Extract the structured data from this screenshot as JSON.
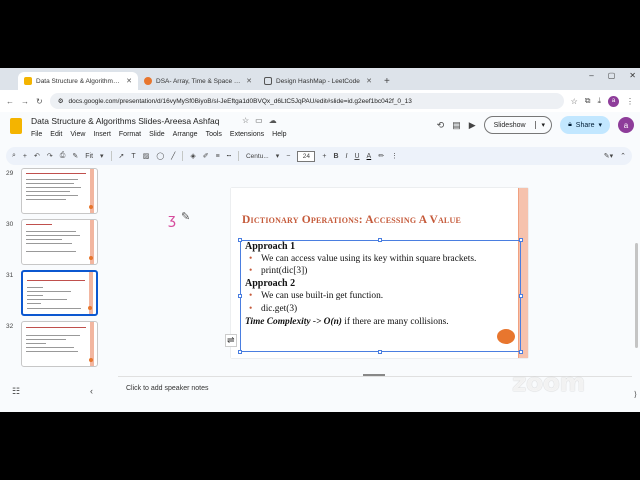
{
  "browser": {
    "tabs": [
      {
        "label": "Data Structure & Algorithms Sl",
        "active": true,
        "favicon_color": "#f4b400"
      },
      {
        "label": "DSA- Array, Time & Space Com",
        "active": false,
        "favicon_color": "#e8762e"
      },
      {
        "label": "Design HashMap - LeetCode",
        "active": false,
        "favicon_color": "#555555"
      }
    ],
    "new_tab": "+",
    "window_controls": [
      "–",
      "▢",
      "✕"
    ],
    "url": "docs.google.com/presentation/d/16vyMySf0BiyoB/sl-JeEftga1d0BVQx_d6LtC5JqPAU/edit#slide=id.g2eef1bc042f_0_13",
    "profile_initial": "a"
  },
  "doc": {
    "title": "Data Structure & Algorithms Slides-Areesa Ashfaq",
    "menu": [
      "File",
      "Edit",
      "View",
      "Insert",
      "Format",
      "Slide",
      "Arrange",
      "Tools",
      "Extensions",
      "Help"
    ],
    "slideshow_label": "Slideshow",
    "share_label": "Share",
    "user_initial": "a"
  },
  "toolbar": {
    "zoom": "Fit",
    "font": "Centu...",
    "font_size": "24"
  },
  "filmstrip": [
    {
      "number": "29",
      "selected": false
    },
    {
      "number": "30",
      "selected": false
    },
    {
      "number": "31",
      "selected": true
    },
    {
      "number": "32",
      "selected": false
    }
  ],
  "slide": {
    "title": "Dictionary Operations: Accessing A Value",
    "heading1": "Approach 1",
    "bullet1a": "We can access value using its key within square brackets.",
    "bullet1b": "print(dic[3])",
    "heading2": "Approach 2",
    "bullet2a": "We can use built-in get function.",
    "bullet2b": "dic.get(3)",
    "complexity_label": "Time Complexity -> O(n)",
    "complexity_rest": " if there are many collisions.",
    "accent_color": "#c55a3a"
  },
  "ink_annotation": "ʒ",
  "notes": {
    "placeholder": "Click to add speaker notes"
  },
  "watermark": "zoom"
}
